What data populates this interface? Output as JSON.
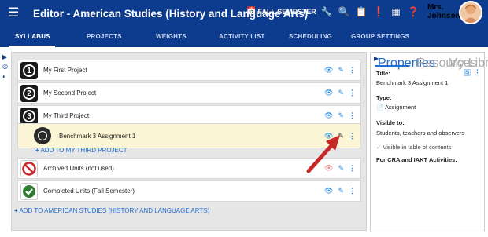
{
  "header": {
    "menu_icon": "hamburger-icon",
    "title": "Editor - American Studies (History and Language Arts)",
    "semester": "FALL SEMESTER",
    "user_name_line1": "Mrs.",
    "user_name_line2": "Johnson"
  },
  "tabs": [
    {
      "label": "SYLLABUS",
      "active": true
    },
    {
      "label": "PROJECTS"
    },
    {
      "label": "WEIGHTS"
    },
    {
      "label": "ACTIVITY LIST"
    },
    {
      "label": "SCHEDULING"
    },
    {
      "label": "GROUP SETTINGS"
    }
  ],
  "rows": [
    {
      "badge": "1",
      "label": "My First Project"
    },
    {
      "badge": "2",
      "label": "My Second Project"
    },
    {
      "badge": "3",
      "label": "My Third Project"
    },
    {
      "label": "Benchmark 3 Assignment 1"
    },
    {
      "label": "Archived Units (not used)"
    },
    {
      "label": "Completed Units (Fall Semester)"
    }
  ],
  "add_links": {
    "third_project": "ADD TO MY THIRD PROJECT",
    "course": "ADD TO AMERICAN STUDIES (HISTORY AND LANGUAGE ARTS)"
  },
  "right_panel": {
    "tabs": [
      "Properties",
      "Resources",
      "My Library"
    ],
    "title_label": "Title:",
    "title_value": "Benchmark 3 Assignment 1",
    "type_label": "Type:",
    "type_value": "Assignment",
    "visible_label": "Visible to:",
    "visible_value": "Students, teachers and observers",
    "visible_toc": "Visible in table of contents",
    "cra_label": "For CRA and IAKT Activities:"
  },
  "colors": {
    "header_bg": "#0d3b8e",
    "accent": "#1e88e5",
    "highlight_row": "#fcf5d6",
    "arrow": "#c62828"
  }
}
